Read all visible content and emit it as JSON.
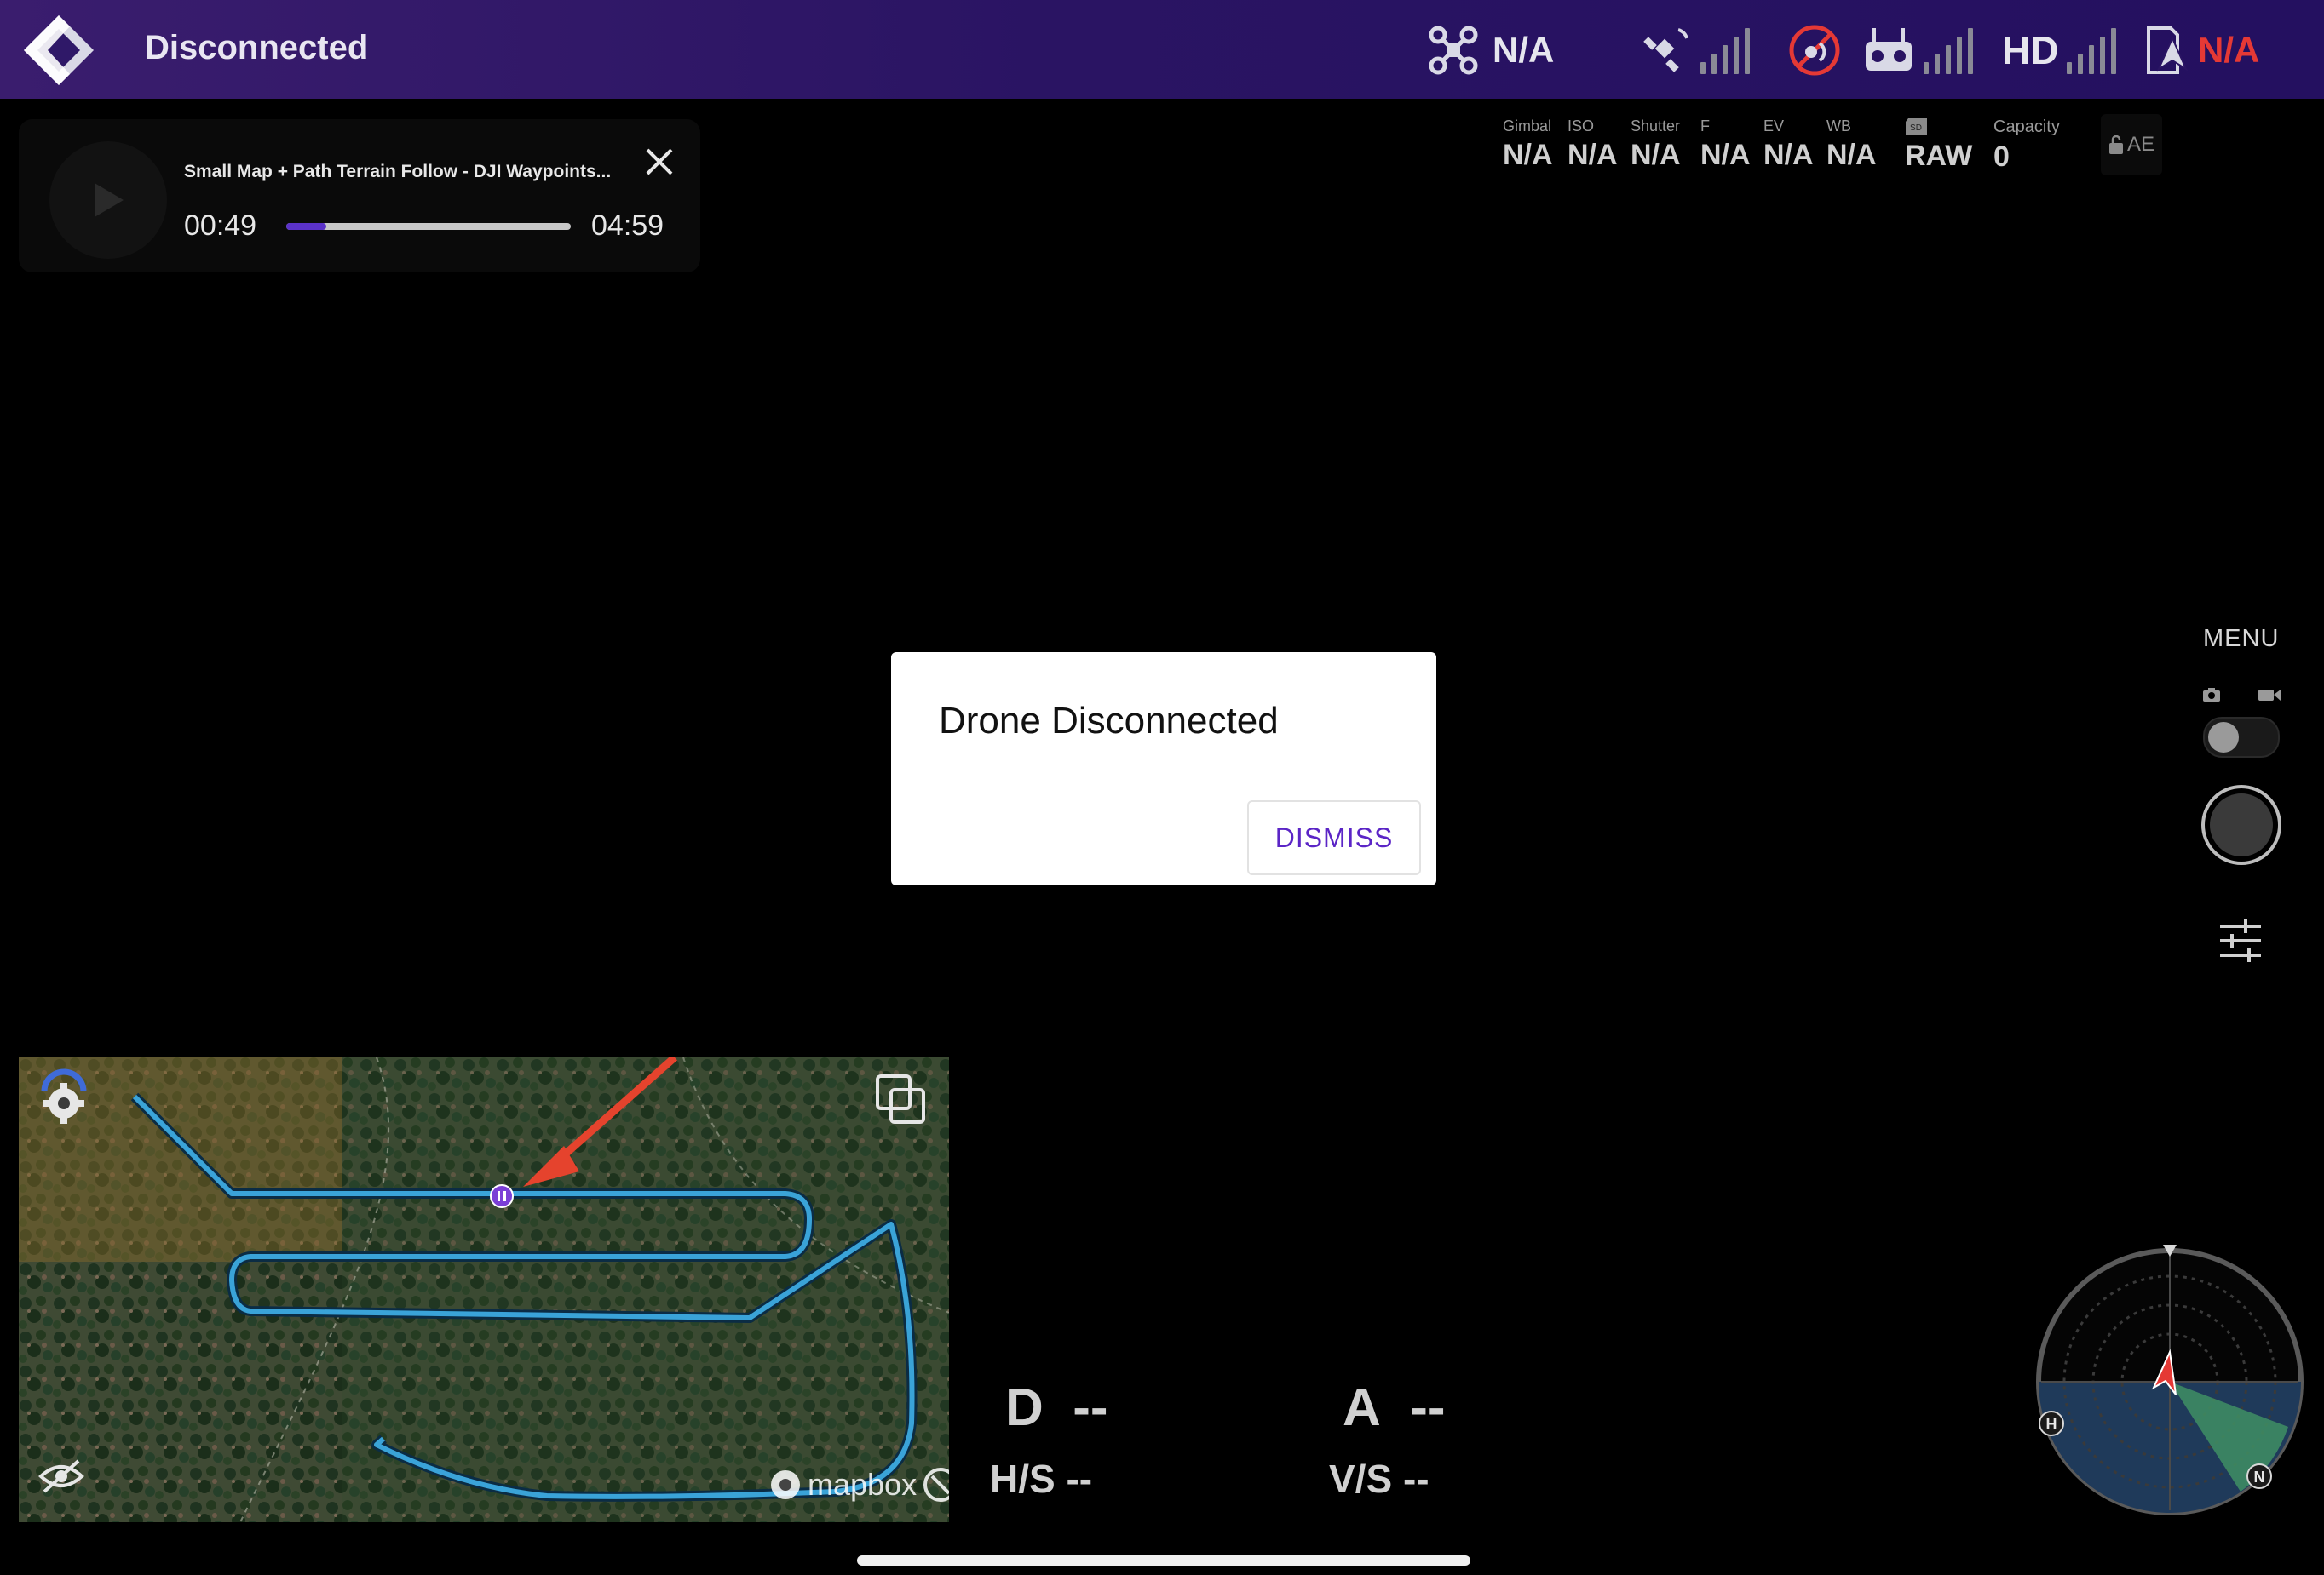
{
  "topbar": {
    "connection_status": "Disconnected",
    "drone_model": "N/A",
    "remaining_flight": "N/A",
    "video_quality": "HD"
  },
  "camera_params": {
    "gimbal": {
      "label": "Gimbal",
      "value": "N/A"
    },
    "iso": {
      "label": "ISO",
      "value": "N/A"
    },
    "shutter": {
      "label": "Shutter",
      "value": "N/A"
    },
    "f": {
      "label": "F",
      "value": "N/A"
    },
    "ev": {
      "label": "EV",
      "value": "N/A"
    },
    "wb": {
      "label": "WB",
      "value": "N/A"
    },
    "format": {
      "value": "RAW"
    },
    "capacity": {
      "label": "Capacity",
      "value": "0"
    },
    "ae_label": "AE"
  },
  "player": {
    "title": "Small Map + Path Terrain Follow - DJI Waypoints...",
    "current_time": "00:49",
    "total_time": "04:59",
    "progress": 0.14
  },
  "dialog": {
    "title": "Drone Disconnected",
    "dismiss_label": "DISMISS"
  },
  "right_panel": {
    "menu_label": "MENU"
  },
  "telemetry": {
    "distance_label": "D",
    "distance_value": "--",
    "altitude_label": "A",
    "altitude_value": "--",
    "hs_label": "H/S",
    "hs_value": "--",
    "vs_label": "V/S",
    "vs_value": "--"
  },
  "map": {
    "attribution": "mapbox"
  },
  "compass": {
    "home_label": "H",
    "north_label": "N"
  },
  "colors": {
    "accent": "#5b25c6",
    "topbar_start": "#3a1d6e",
    "path": "#3aa3d8",
    "alert_red": "#e53935"
  },
  "icons": {
    "logo": "app-logo",
    "drone": "drone-icon",
    "gps": "satellite-icon",
    "obstacle": "obstacle-avoidance-off-icon",
    "remote": "remote-controller-icon",
    "flight_mode": "flight-mode-icon"
  }
}
